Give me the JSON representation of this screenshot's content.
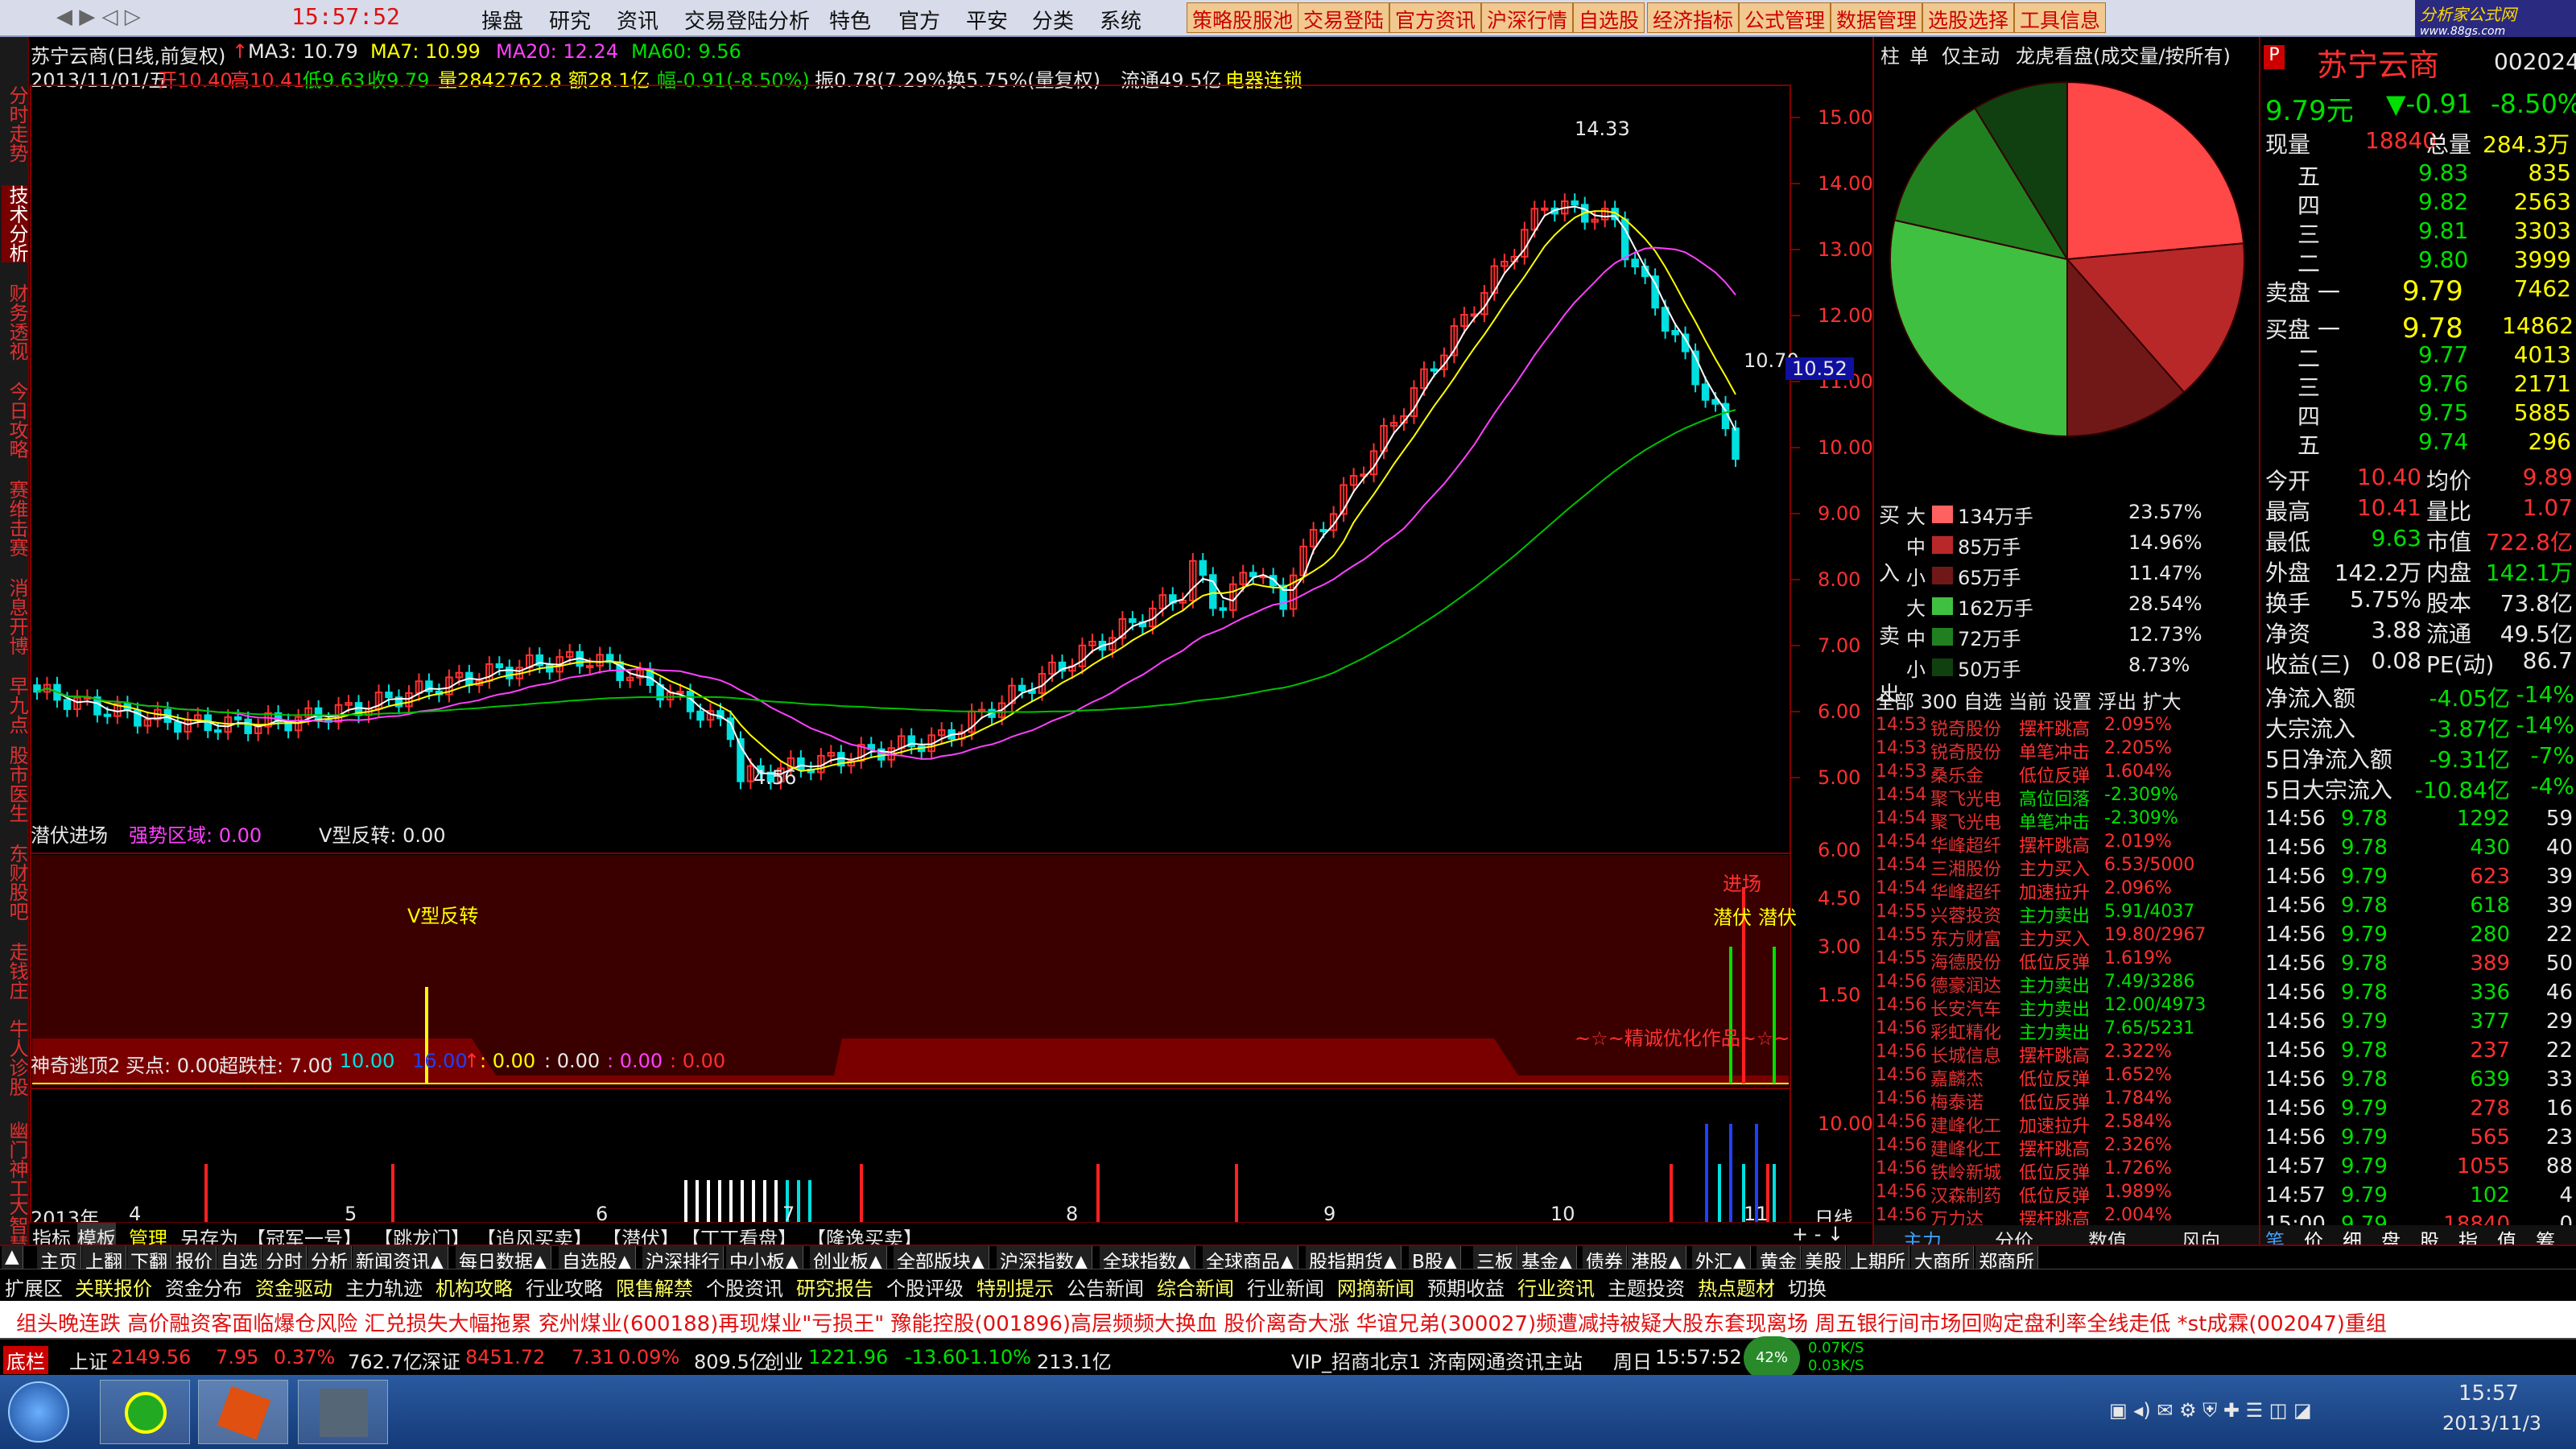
{
  "menu": {
    "clock": "15:57:52",
    "items": [
      "操盘",
      "研究",
      "资讯",
      "交易登陆分析",
      "特色",
      "官方",
      "平安",
      "分类",
      "系统"
    ],
    "highlight": [
      "策略股服池",
      "交易登陆",
      "官方资讯",
      "沪深行情",
      "自选股",
      "经济指标",
      "公式管理",
      "数据管理",
      "选股选择",
      "工具信息"
    ],
    "logo": "分析家公式网",
    "logo_sub": "www.88gs.com"
  },
  "vtabs": [
    "分时走势",
    "技术分析",
    "财务透视",
    "今日攻略",
    "赛维击赛",
    "消息开博",
    "早九点",
    "股市医生",
    "东财股吧",
    "走钱庄",
    "牛人诊股",
    "幽门神工",
    "大智慧"
  ],
  "header": {
    "title": "苏宁云商(日线,前复权)",
    "ma3": "MA3: 10.79",
    "ma7": "MA7: 10.99",
    "ma20": "MA20: 12.24",
    "ma60": "MA60: 9.56",
    "line2": "2013/11/01/五",
    "open": "开10.40",
    "high": "高10.41",
    "low": "低9.63",
    "close": "收9.79",
    "vol": "量2842762.8",
    "amount": "额28.1亿",
    "chg": "幅-0.91(-8.50%)",
    "amp": "振0.78(7.29%)",
    "turn": "换5.75%(量复权)",
    "float": "流通49.5亿",
    "sector": "电器连锁"
  },
  "price_axis": [
    "15.00",
    "14.00",
    "13.00",
    "12.00",
    "11.00",
    "10.00",
    "9.00",
    "8.00",
    "7.00",
    "6.00",
    "5.00"
  ],
  "price_marks": {
    "hi": "14.33",
    "lo": "4.56",
    "last": "10.70",
    "cur": "10.52"
  },
  "ind1": {
    "title": "潜伏进场",
    "strong": "强势区域: 0.00",
    "vrev": "V型反转: 0.00",
    "vlabel": "V型反转",
    "enter": "进场",
    "lurk": "潜伏",
    "lurk2": "潜伏",
    "footer": "~☆~精诚优化作品~☆~",
    "axis": [
      "6.00",
      "4.50",
      "3.00",
      "1.50"
    ]
  },
  "ind2": {
    "title": "神奇逃顶2",
    "buy": "买点: 0.00",
    "super": "超跌柱: 7.00",
    "v10": ": 10.00",
    "v16": "16.00",
    "z1": ": 0.00",
    "z2": ": 0.00",
    "z3": ": 0.00",
    "z4": ": 0.00",
    "axis": "10.00"
  },
  "xaxis": [
    "2013年",
    "4",
    "5",
    "6",
    "7",
    "8",
    "9",
    "10",
    "11"
  ],
  "xaxis_right": "日线",
  "panel_tabs": [
    "指标",
    "模板",
    "管理",
    "另存为",
    "【冠军一号】",
    "【跳龙门】",
    "【追风买卖】",
    "【潜伏】",
    "【丁丁看盘】",
    "【隆逸买卖】"
  ],
  "mid": {
    "tabs": [
      "柱",
      "单",
      "仅主动",
      "龙虎看盘(成交量/按所有)"
    ],
    "buy": [
      {
        "k": "大",
        "v": "134万手",
        "p": "23.57%"
      },
      {
        "k": "中",
        "v": "85万手",
        "p": "14.96%"
      },
      {
        "k": "小",
        "v": "65万手",
        "p": "11.47%"
      }
    ],
    "sell": [
      {
        "k": "大",
        "v": "162万手",
        "p": "28.54%"
      },
      {
        "k": "中",
        "v": "72万手",
        "p": "12.73%"
      },
      {
        "k": "小",
        "v": "50万手",
        "p": "8.73%"
      }
    ],
    "side_buy": [
      "买",
      "入"
    ],
    "side_sell": [
      "卖",
      "出"
    ],
    "filter": "全部 300 自选 当前 设置 浮出 扩大",
    "news": [
      [
        "14:53",
        "锐奇股份",
        "摆杆跳高",
        "2.095%"
      ],
      [
        "14:53",
        "锐奇股份",
        "单笔冲击",
        "2.205%"
      ],
      [
        "14:53",
        "桑乐金",
        "低位反弹",
        "1.604%"
      ],
      [
        "14:54",
        "聚飞光电",
        "高位回落",
        "-2.309%"
      ],
      [
        "14:54",
        "聚飞光电",
        "单笔冲击",
        "-2.309%"
      ],
      [
        "14:54",
        "华峰超纤",
        "摆杆跳高",
        "2.019%"
      ],
      [
        "14:54",
        "三湘股份",
        "主力买入",
        "6.53/5000"
      ],
      [
        "14:54",
        "华峰超纤",
        "加速拉升",
        "2.096%"
      ],
      [
        "14:55",
        "兴蓉投资",
        "主力卖出",
        "5.91/4037"
      ],
      [
        "14:55",
        "东方财富",
        "主力买入",
        "19.80/2967"
      ],
      [
        "14:55",
        "海德股份",
        "低位反弹",
        "1.619%"
      ],
      [
        "14:56",
        "德豪润达",
        "主力卖出",
        "7.49/3286"
      ],
      [
        "14:56",
        "长安汽车",
        "主力卖出",
        "12.00/4973"
      ],
      [
        "14:56",
        "彩虹精化",
        "主力卖出",
        "7.65/5231"
      ],
      [
        "14:56",
        "长城信息",
        "摆杆跳高",
        "2.322%"
      ],
      [
        "14:56",
        "嘉麟杰",
        "低位反弹",
        "1.652%"
      ],
      [
        "14:56",
        "梅泰诺",
        "低位反弹",
        "1.784%"
      ],
      [
        "14:56",
        "建峰化工",
        "加速拉升",
        "2.584%"
      ],
      [
        "14:56",
        "建峰化工",
        "摆杆跳高",
        "2.326%"
      ],
      [
        "14:56",
        "铁岭新城",
        "低位反弹",
        "1.726%"
      ],
      [
        "14:56",
        "汉森制药",
        "低位反弹",
        "1.989%"
      ],
      [
        "14:56",
        "万力达",
        "摆杆跳高",
        "2.004%"
      ]
    ],
    "bottom": [
      "主力",
      "分价",
      "数值",
      "风向"
    ]
  },
  "quote": {
    "name": "苏宁云商",
    "code": "002024",
    "price": "9.79元",
    "chg": "▼-0.91",
    "pct": "-8.50%",
    "now_l": "现量",
    "now": "18840",
    "tot_l": "总量",
    "tot": "284.3万",
    "asks": [
      [
        "五",
        "9.83",
        "835"
      ],
      [
        "四",
        "9.82",
        "2563"
      ],
      [
        "三",
        "9.81",
        "3303"
      ],
      [
        "二",
        "9.80",
        "3999"
      ],
      [
        "卖盘 一",
        "9.79",
        "7462"
      ]
    ],
    "bids": [
      [
        "买盘 一",
        "9.78",
        "14862"
      ],
      [
        "二",
        "9.77",
        "4013"
      ],
      [
        "三",
        "9.76",
        "2171"
      ],
      [
        "四",
        "9.75",
        "5885"
      ],
      [
        "五",
        "9.74",
        "296"
      ]
    ],
    "stats": [
      [
        "今开",
        "10.40",
        "均价",
        "9.89"
      ],
      [
        "最高",
        "10.41",
        "量比",
        "1.07"
      ],
      [
        "最低",
        "9.63",
        "市值",
        "722.8亿"
      ],
      [
        "外盘",
        "142.2万",
        "内盘",
        "142.1万"
      ],
      [
        "换手",
        "5.75%",
        "股本",
        "73.8亿"
      ],
      [
        "净资",
        "3.88",
        "流通",
        "49.5亿"
      ],
      [
        "收益(三)",
        "0.08",
        "PE(动)",
        "86.7"
      ]
    ],
    "flow": [
      [
        "净流入额",
        "-4.05亿",
        "-14%"
      ],
      [
        "大宗流入",
        "-3.87亿",
        "-14%"
      ],
      [
        "5日净流入额",
        "-9.31亿",
        "-7%"
      ],
      [
        "5日大宗流入",
        "-10.84亿",
        "-4%"
      ]
    ],
    "ticks": [
      [
        "14:56",
        "9.78",
        "1292",
        "59"
      ],
      [
        "14:56",
        "9.78",
        "430",
        "40"
      ],
      [
        "14:56",
        "9.79",
        "623",
        "39"
      ],
      [
        "14:56",
        "9.78",
        "618",
        "39"
      ],
      [
        "14:56",
        "9.79",
        "280",
        "22"
      ],
      [
        "14:56",
        "9.78",
        "389",
        "50"
      ],
      [
        "14:56",
        "9.78",
        "336",
        "46"
      ],
      [
        "14:56",
        "9.79",
        "377",
        "29"
      ],
      [
        "14:56",
        "9.78",
        "237",
        "22"
      ],
      [
        "14:56",
        "9.78",
        "639",
        "33"
      ],
      [
        "14:56",
        "9.79",
        "278",
        "16"
      ],
      [
        "14:56",
        "9.79",
        "565",
        "23"
      ],
      [
        "14:57",
        "9.79",
        "1055",
        "88"
      ],
      [
        "14:57",
        "9.79",
        "102",
        "4"
      ],
      [
        "15:00",
        "9.79",
        "18840",
        "0"
      ]
    ],
    "bottom": [
      "笔",
      "价",
      "细",
      "盘",
      "股",
      "指",
      "值",
      "筹"
    ]
  },
  "nav": [
    "▲",
    "主页",
    "上翻",
    "下翻",
    "报价",
    "自选",
    "分时",
    "分析",
    "新闻资讯▲",
    "每日数据▲",
    "自选股▲",
    "沪深排行",
    "中小板▲",
    "创业板▲",
    "全部版块▲",
    "沪深指数▲",
    "全球指数▲",
    "全球商品▲",
    "股指期货▲",
    "B股▲",
    "三板",
    "基金▲",
    "债券",
    "港股▲",
    "外汇▲",
    "黄金",
    "美股",
    "上期所",
    "大商所",
    "郑商所"
  ],
  "func": [
    "扩展区",
    "关联报价",
    "资金分布",
    "资金驱动",
    "主力轨迹",
    "机构攻略",
    "行业攻略",
    "限售解禁",
    "个股资讯",
    "研究报告",
    "个股评级",
    "特别提示",
    "公告新闻",
    "综合新闻",
    "行业新闻",
    "网摘新闻",
    "预期收益",
    "行业资讯",
    "主题投资",
    "热点题材",
    "切换"
  ],
  "ticker": "组头晚连跌 高价融资客面临爆仓风险      汇兑损失大幅拖累 兖州煤业(600188)再现煤业\"亏损王\"      豫能控股(001896)高层频频大换血 股价离奇大涨      华谊兄弟(300027)频遭减持被疑大股东套现离场      周五银行间市场回购定盘利率全线走低      *st成霖(002047)重组",
  "index": {
    "label": "底栏",
    "sh_l": "上证",
    "sh": "2149.56",
    "sh_c": "7.95",
    "sh_p": "0.37%",
    "sh_a": "762.7亿",
    "sz_l": "深证",
    "sz": "8451.72",
    "sz_c": "7.31",
    "sz_p": "0.09%",
    "sz_a": "809.5亿",
    "cy_l": "创业",
    "cy": "1221.96",
    "cy_c": "-13.60",
    "cy_p": "-1.10%",
    "cy_a": "213.1亿",
    "vip": "VIP_招商北京1",
    "site": "济南网通资讯主站",
    "day": "周日",
    "time": "15:57:52",
    "net_pct": "42%",
    "up": "0.07K/S",
    "down": "0.03K/S"
  },
  "taskbar": {
    "time": "15:57",
    "date": "2013/11/3"
  },
  "pie": [
    {
      "name": "买大",
      "pct": 23.57,
      "color": "#ff4848"
    },
    {
      "name": "买中",
      "pct": 14.96,
      "color": "#b82828"
    },
    {
      "name": "买小",
      "pct": 11.47,
      "color": "#701818"
    },
    {
      "name": "卖大",
      "pct": 28.54,
      "color": "#40c040"
    },
    {
      "name": "卖中",
      "pct": 12.73,
      "color": "#208020"
    },
    {
      "name": "卖小",
      "pct": 8.73,
      "color": "#104010"
    }
  ]
}
